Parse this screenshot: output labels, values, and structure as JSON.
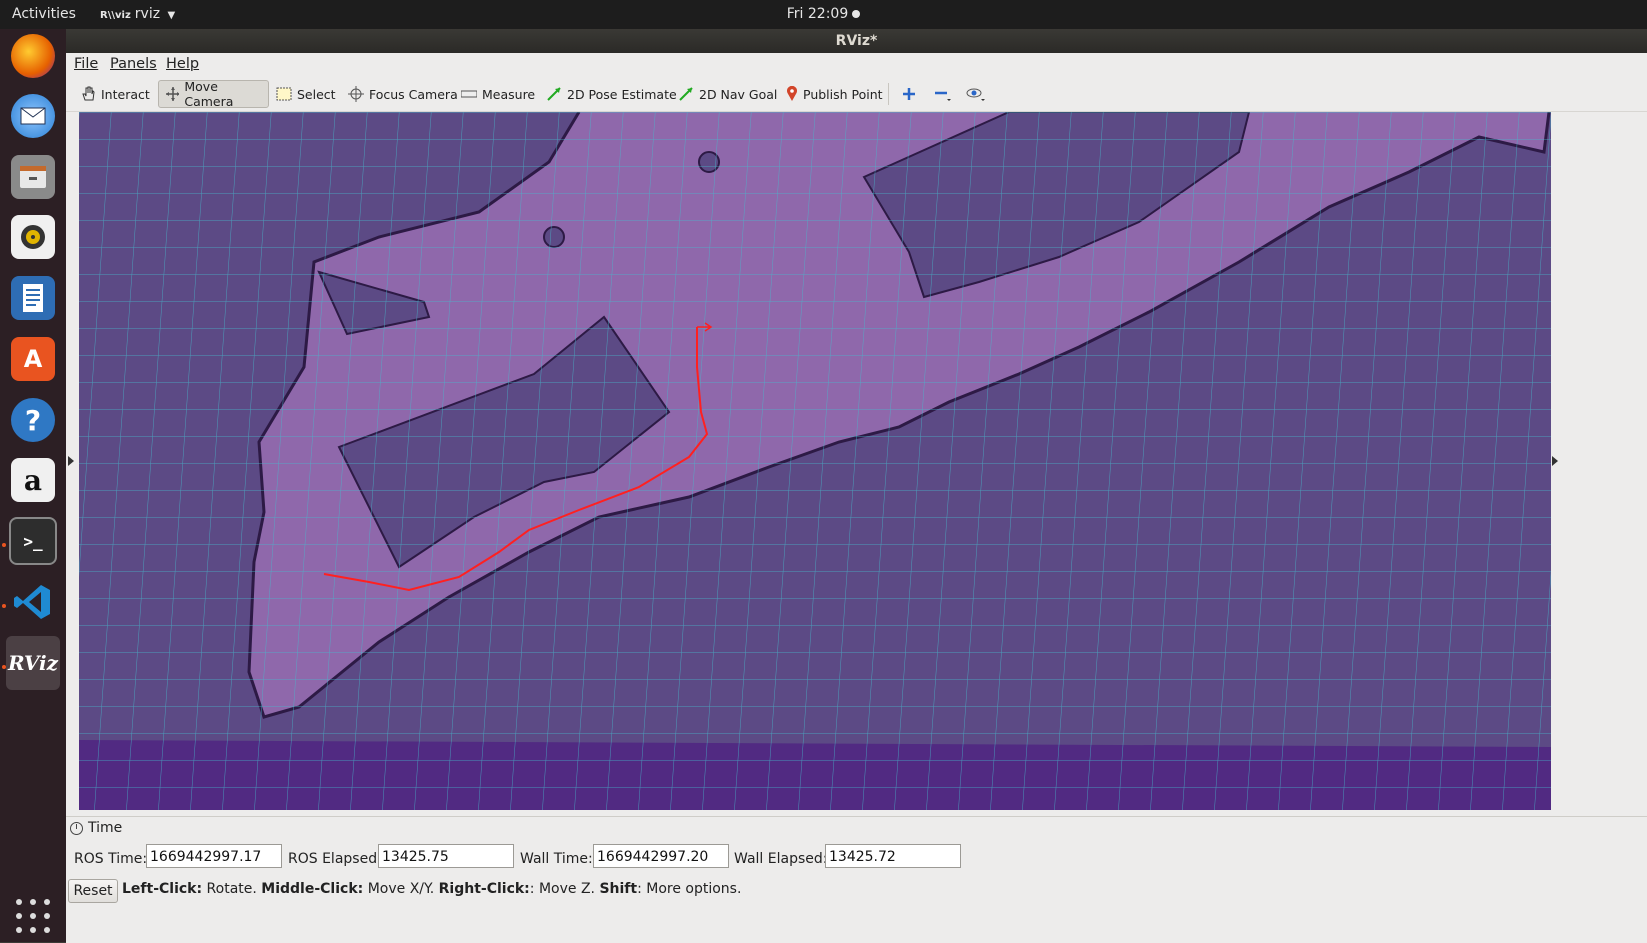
{
  "topbar": {
    "activities": "Activities",
    "app_icon_text": "R\\\\viz",
    "app_name": "rviz",
    "clock": "Fri 22:09"
  },
  "dock": {
    "items": [
      {
        "name": "firefox",
        "icon": "firefox-icon",
        "color": "#e66000"
      },
      {
        "name": "thunderbird",
        "icon": "mail-icon",
        "color": "#2a7fd4"
      },
      {
        "name": "files",
        "icon": "files-icon",
        "color": "#7a7a7a"
      },
      {
        "name": "rhythmbox",
        "icon": "speaker-icon",
        "color": "#d9a400"
      },
      {
        "name": "libreoffice-writer",
        "icon": "document-icon",
        "color": "#2e6db4"
      },
      {
        "name": "ubuntu-software",
        "icon": "store-icon",
        "color": "#e95420"
      },
      {
        "name": "help",
        "icon": "help-icon",
        "color": "#2f78c4"
      },
      {
        "name": "amazon",
        "icon": "amazon-icon",
        "color": "#f0f0f0"
      },
      {
        "name": "terminal",
        "icon": "terminal-icon",
        "color": "#2d2d2d"
      },
      {
        "name": "vscode",
        "icon": "vscode-icon",
        "color": "#1f8ad2"
      },
      {
        "name": "rviz",
        "icon": "rviz-icon",
        "color": "#3c3b37",
        "label": "RViz"
      }
    ]
  },
  "window": {
    "title": "RViz*"
  },
  "menu": {
    "file": "File",
    "panels": "Panels",
    "help": "Help"
  },
  "toolbar": {
    "interact": "Interact",
    "move_camera": "Move Camera",
    "select": "Select",
    "focus_camera": "Focus Camera",
    "measure": "Measure",
    "pose_estimate": "2D Pose Estimate",
    "nav_goal": "2D Nav Goal",
    "publish_point": "Publish Point",
    "active_tool": "Move Camera"
  },
  "time_panel": {
    "title": "Time",
    "ros_time_label": "ROS Time:",
    "ros_time": "1669442997.17",
    "ros_elapsed_label": "ROS Elapsed:",
    "ros_elapsed": "13425.75",
    "wall_time_label": "Wall Time:",
    "wall_time": "1669442997.20",
    "wall_elapsed_label": "Wall Elapsed:",
    "wall_elapsed": "13425.72"
  },
  "status": {
    "reset": "Reset",
    "left_click": "Left-Click:",
    "left_action": " Rotate. ",
    "middle_click": "Middle-Click:",
    "middle_action": " Move X/Y. ",
    "right_click": "Right-Click:",
    "right_action": ": Move Z. ",
    "shift": "Shift",
    "shift_action": ": More options."
  },
  "colors": {
    "map_unknown": "#512a82",
    "map_occupied": "#5c4a85",
    "map_free": "#8f68ab",
    "grid": "#45b9cc",
    "path": "#ff2020"
  }
}
